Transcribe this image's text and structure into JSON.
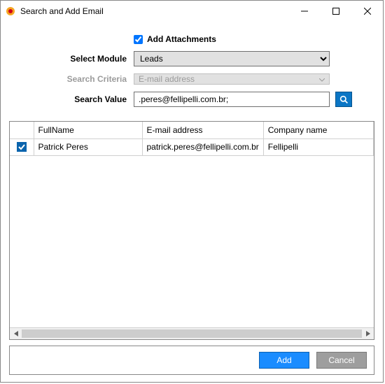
{
  "window": {
    "title": "Search and Add Email"
  },
  "form": {
    "add_attachments_label": "Add Attachments",
    "add_attachments_checked": true,
    "module_label": "Select Module",
    "module_value": "Leads",
    "criteria_label": "Search Criteria",
    "criteria_value": "E-mail address",
    "value_label": "Search Value",
    "value_text": ".peres@fellipelli.com.br;"
  },
  "grid": {
    "columns": {
      "fullname": "FullName",
      "email": "E-mail address",
      "company": "Company name"
    },
    "rows": [
      {
        "checked": true,
        "fullname": "Patrick Peres",
        "email": "patrick.peres@fellipelli.com.br",
        "company": "Fellipelli"
      }
    ]
  },
  "footer": {
    "add": "Add",
    "cancel": "Cancel"
  }
}
